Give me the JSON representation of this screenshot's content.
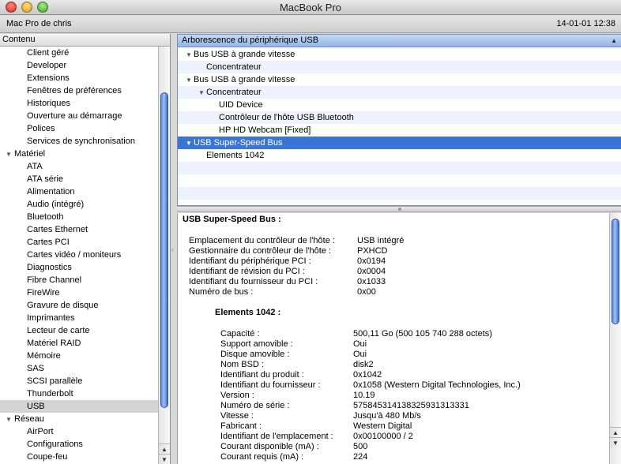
{
  "window": {
    "title": "MacBook Pro"
  },
  "infobar": {
    "computer_name": "Mac Pro de chris",
    "datetime": "14-01-01 12:38"
  },
  "sidebar": {
    "header": "Contenu",
    "items": [
      {
        "label": "Client géré",
        "type": "item"
      },
      {
        "label": "Developer",
        "type": "item"
      },
      {
        "label": "Extensions",
        "type": "item"
      },
      {
        "label": "Fenêtres de préférences",
        "type": "item"
      },
      {
        "label": "Historiques",
        "type": "item"
      },
      {
        "label": "Ouverture au démarrage",
        "type": "item"
      },
      {
        "label": "Polices",
        "type": "item"
      },
      {
        "label": "Services de synchronisation",
        "type": "item"
      },
      {
        "label": "Matériel",
        "type": "group"
      },
      {
        "label": "ATA",
        "type": "item"
      },
      {
        "label": "ATA série",
        "type": "item"
      },
      {
        "label": "Alimentation",
        "type": "item"
      },
      {
        "label": "Audio (intégré)",
        "type": "item"
      },
      {
        "label": "Bluetooth",
        "type": "item"
      },
      {
        "label": "Cartes Ethernet",
        "type": "item"
      },
      {
        "label": "Cartes PCI",
        "type": "item"
      },
      {
        "label": "Cartes vidéo / moniteurs",
        "type": "item"
      },
      {
        "label": "Diagnostics",
        "type": "item"
      },
      {
        "label": "Fibre Channel",
        "type": "item"
      },
      {
        "label": "FireWire",
        "type": "item"
      },
      {
        "label": "Gravure de disque",
        "type": "item"
      },
      {
        "label": "Imprimantes",
        "type": "item"
      },
      {
        "label": "Lecteur de carte",
        "type": "item"
      },
      {
        "label": "Matériel RAID",
        "type": "item"
      },
      {
        "label": "Mémoire",
        "type": "item"
      },
      {
        "label": "SAS",
        "type": "item"
      },
      {
        "label": "SCSI parallèle",
        "type": "item"
      },
      {
        "label": "Thunderbolt",
        "type": "item"
      },
      {
        "label": "USB",
        "type": "item",
        "selected": true
      },
      {
        "label": "Réseau",
        "type": "group"
      },
      {
        "label": "AirPort",
        "type": "item"
      },
      {
        "label": "Configurations",
        "type": "item"
      },
      {
        "label": "Coupe-feu",
        "type": "item"
      }
    ]
  },
  "tree": {
    "header": "Arborescence du périphérique USB",
    "rows": [
      {
        "label": "Bus USB à grande vitesse",
        "indent": 0,
        "expanded": true
      },
      {
        "label": "Concentrateur",
        "indent": 1,
        "expanded": false
      },
      {
        "label": "Bus USB à grande vitesse",
        "indent": 0,
        "expanded": true
      },
      {
        "label": "Concentrateur",
        "indent": 1,
        "expanded": true
      },
      {
        "label": "UID Device",
        "indent": 2,
        "expanded": false
      },
      {
        "label": "Contrôleur de l'hôte USB Bluetooth",
        "indent": 2,
        "expanded": false
      },
      {
        "label": "HP HD Webcam [Fixed]",
        "indent": 2,
        "expanded": false
      },
      {
        "label": "USB Super-Speed Bus",
        "indent": 0,
        "expanded": true,
        "selected": true
      },
      {
        "label": "Elements 1042",
        "indent": 1,
        "expanded": false
      },
      {
        "label": "",
        "indent": 0
      },
      {
        "label": "",
        "indent": 0
      },
      {
        "label": "",
        "indent": 0
      },
      {
        "label": "",
        "indent": 0
      }
    ]
  },
  "detail": {
    "title": "USB Super-Speed Bus :",
    "bus_props": [
      {
        "key": "Emplacement du contrôleur de l'hôte :",
        "value": "USB intégré"
      },
      {
        "key": "Gestionnaire du contrôleur de l'hôte :",
        "value": "PXHCD"
      },
      {
        "key": "Identifiant du périphérique PCI :",
        "value": "0x0194"
      },
      {
        "key": "Identifiant de révision du PCI :",
        "value": "0x0004"
      },
      {
        "key": "Identifiant du fournisseur du PCI :",
        "value": "0x1033"
      },
      {
        "key": "Numéro de bus :",
        "value": "0x00"
      }
    ],
    "device_title": "Elements 1042 :",
    "device_props": [
      {
        "key": "Capacité :",
        "value": "500,11 Go (500 105 740 288 octets)"
      },
      {
        "key": "Support amovible :",
        "value": "Oui"
      },
      {
        "key": "Disque amovible :",
        "value": "Oui"
      },
      {
        "key": "Nom BSD :",
        "value": "disk2"
      },
      {
        "key": "Identifiant du produit :",
        "value": "0x1042"
      },
      {
        "key": "Identifiant du fournisseur :",
        "value": "0x1058  (Western Digital Technologies, Inc.)"
      },
      {
        "key": "Version :",
        "value": "10.19"
      },
      {
        "key": "Numéro de série :",
        "value": "575845314138325931313331"
      },
      {
        "key": "Vitesse :",
        "value": "Jusqu'à 480 Mb/s"
      },
      {
        "key": "Fabricant :",
        "value": "Western Digital"
      },
      {
        "key": "Identifiant de l'emplacement :",
        "value": "0x00100000 / 2"
      },
      {
        "key": "Courant disponible (mA) :",
        "value": "500"
      },
      {
        "key": "Courant requis (mA) :",
        "value": "224"
      }
    ]
  }
}
